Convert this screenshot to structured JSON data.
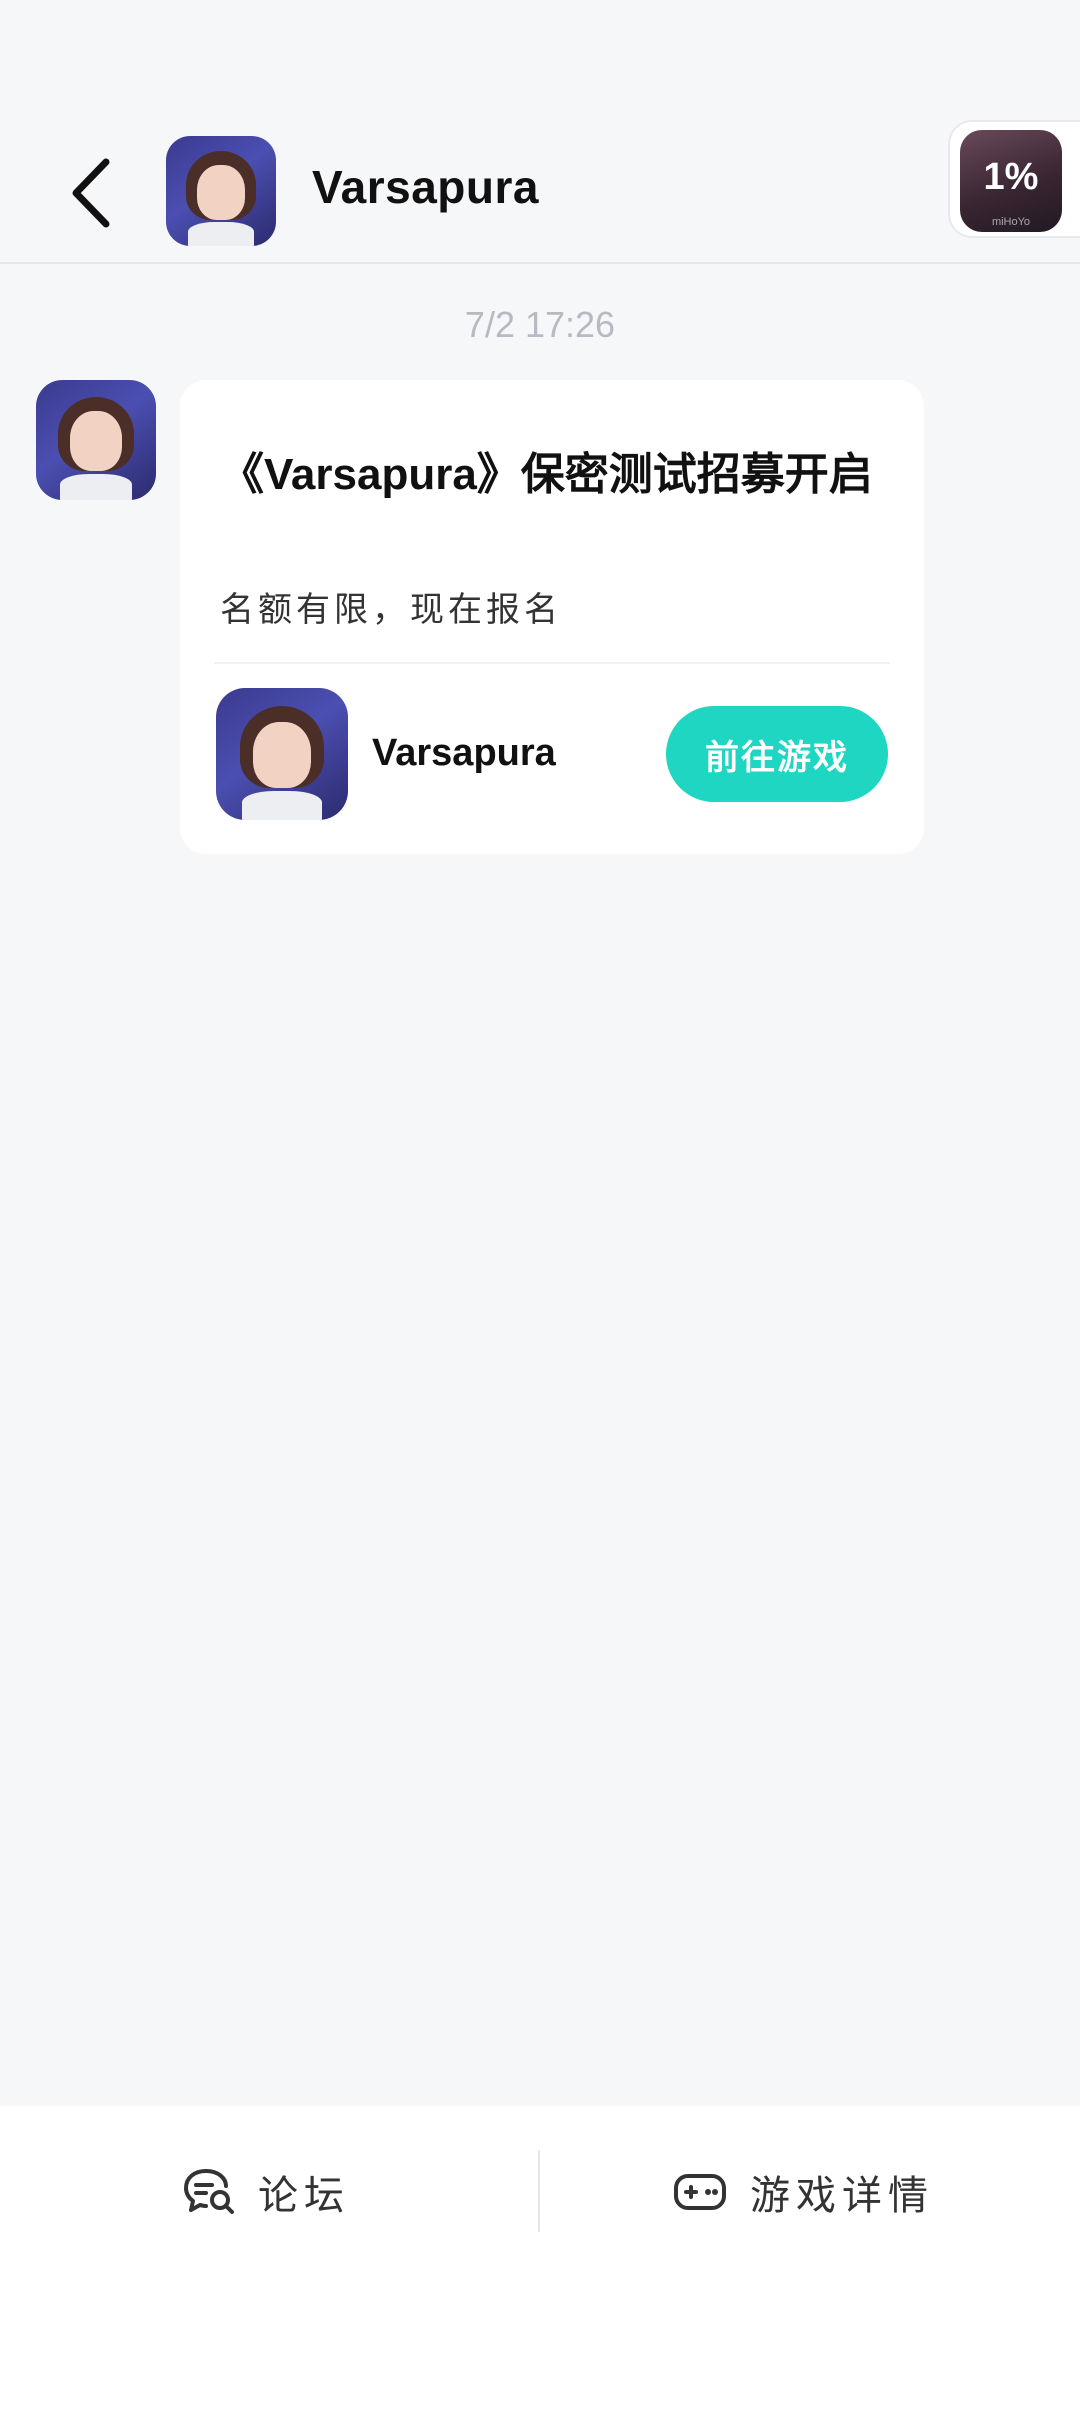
{
  "header": {
    "back_icon": "chevron-left-icon",
    "title": "Varsapura",
    "widget": {
      "percent": "1%",
      "brand": "miHoYo"
    }
  },
  "chat": {
    "timestamp": "7/2   17:26",
    "message": {
      "title": "《Varsapura》保密测试招募开启",
      "description": "名额有限，现在报名",
      "game_name": "Varsapura",
      "cta_label": "前往游戏"
    }
  },
  "bottom_bar": {
    "forum_label": "论坛",
    "forum_icon": "chat-search-icon",
    "details_label": "游戏详情",
    "details_icon": "gamepad-icon"
  },
  "colors": {
    "accent": "#1ed6c1",
    "background": "#f6f7f9",
    "timestamp": "#b7bac1"
  }
}
